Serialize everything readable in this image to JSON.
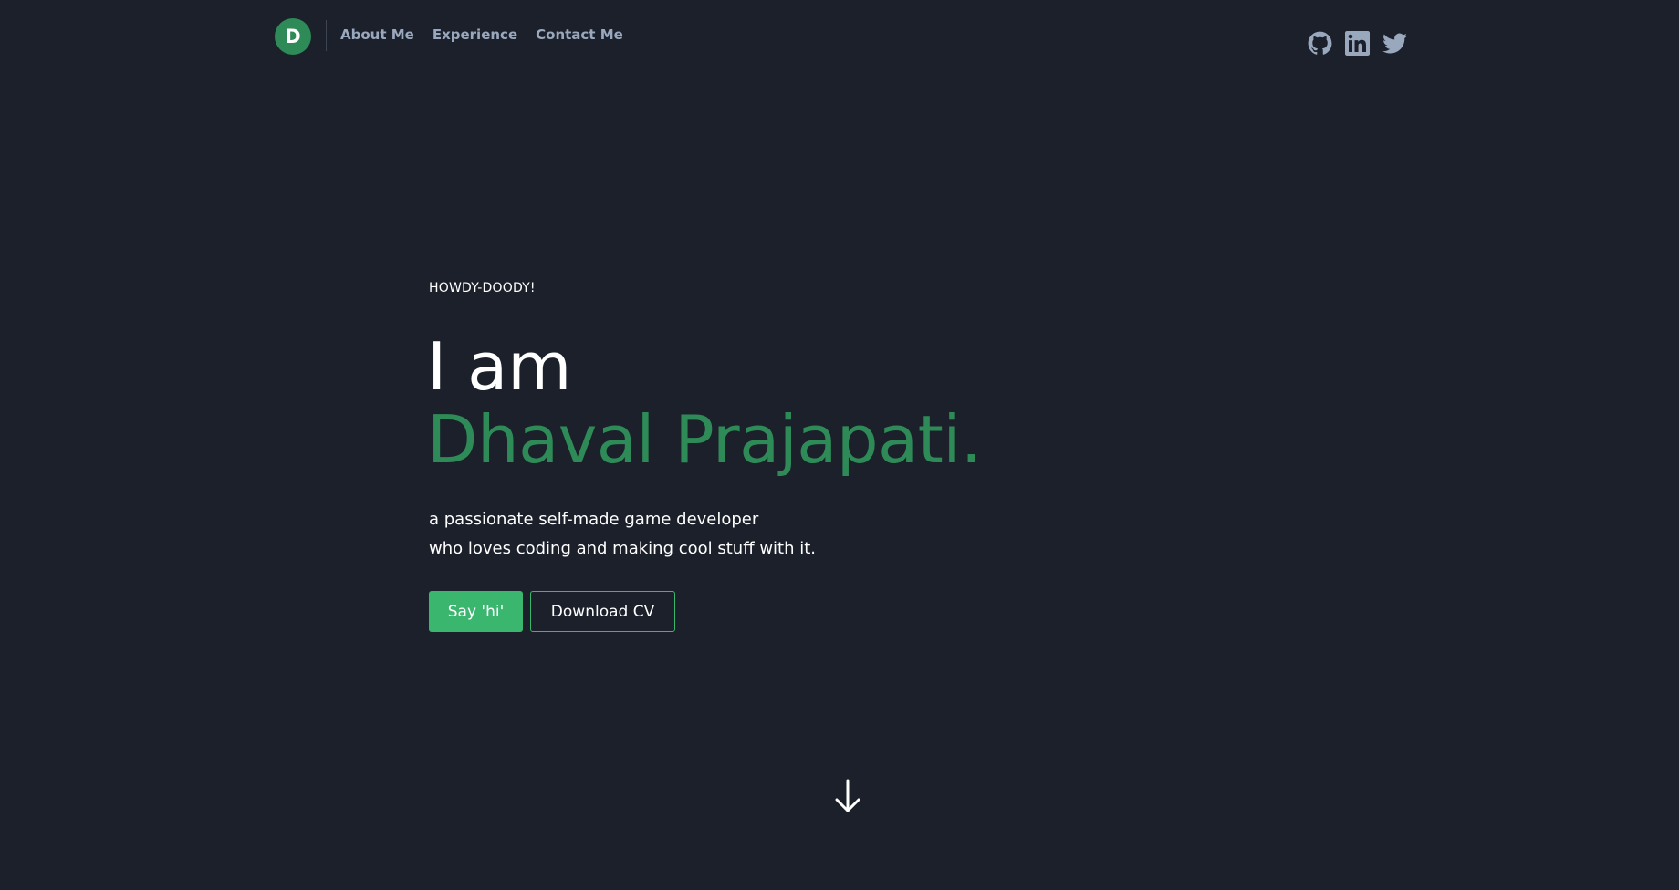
{
  "header": {
    "logo_letter": "D",
    "nav": [
      {
        "label": "About Me"
      },
      {
        "label": "Experience"
      },
      {
        "label": "Contact Me"
      }
    ],
    "socials": [
      {
        "icon": "github-icon"
      },
      {
        "icon": "linkedin-icon"
      },
      {
        "icon": "twitter-icon"
      }
    ]
  },
  "hero": {
    "greeting": "HOWDY-DOODY!",
    "headline_line1": "I am",
    "headline_line2": "Dhaval Prajapati.",
    "tagline_line1": "a passionate self-made game developer",
    "tagline_line2": "who loves coding and making cool stuff with it.",
    "primary_button": "Say 'hi'",
    "secondary_button": "Download CV",
    "scroll_icon": "arrow-down-icon"
  },
  "colors": {
    "background": "#1b202b",
    "accent": "#2e8b57",
    "button_green": "#3ab66f",
    "nav_text": "#9aa8bd",
    "text": "#ffffff"
  }
}
